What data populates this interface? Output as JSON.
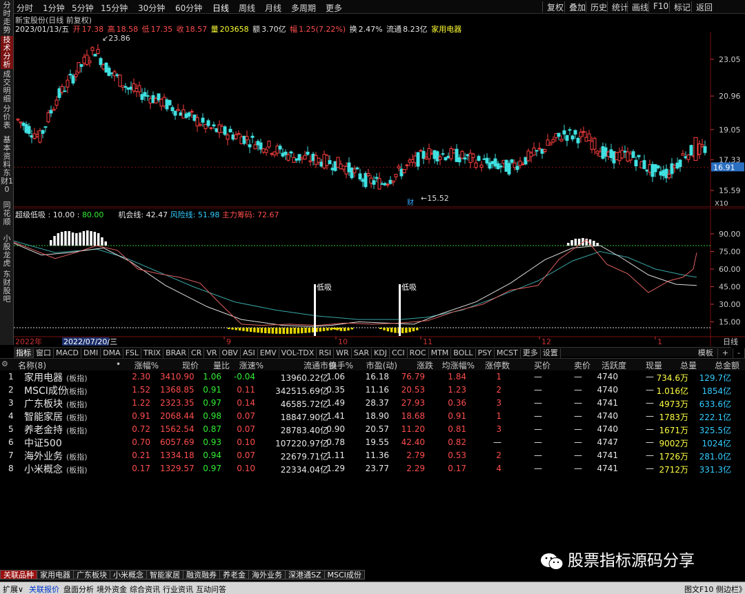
{
  "left_tabs": [
    "分时走势",
    "技术分析",
    "成交明细",
    "分价表",
    "基本资料",
    "东财10",
    "同花顺",
    "小股龙虎",
    "东财股吧"
  ],
  "left_active": 1,
  "toolbar": {
    "periods": [
      "分时",
      "1分钟",
      "5分钟",
      "15分钟",
      "30分钟",
      "60分钟",
      "日线",
      "周线",
      "月线",
      "多周期",
      "更多"
    ],
    "active_period": "日线",
    "right_buttons": [
      "复权",
      "叠加",
      "历史",
      "统计",
      "画线",
      "F10",
      "标记",
      "返回"
    ]
  },
  "stock": {
    "title": "新宝股份(日线 前复权)",
    "date": "2023/01/13/五",
    "open_label": "开",
    "open": "17.38",
    "high_label": "高",
    "high": "18.58",
    "low_label": "低",
    "low": "17.35",
    "close_label": "收",
    "close": "18.57",
    "vol_label": "量",
    "vol": "203658",
    "amt_label": "额",
    "amt": "3.70亿",
    "chg_label": "幅",
    "chg": "1.25(7.22%)",
    "turn_label": "换",
    "turn": "2.47%",
    "float_label": "流通",
    "float": "8.23亿",
    "industry": "家用电器"
  },
  "main_chart": {
    "y_ticks": [
      "23.05",
      "20.96",
      "19.05",
      "17.33",
      "15.59"
    ],
    "current_price": "16.91",
    "max_label": "23.86",
    "min_label": "15.52",
    "cai_label": "财",
    "zoom": "X10",
    "bullish_color": "#ff4040",
    "bearish_color": "#40e0e0"
  },
  "indicator": {
    "name": "超级低吸",
    "p1_label": "10.00",
    "p2_label": "80.00",
    "line1_label": "机会线",
    "line1_val": "42.47",
    "line2_label": "风险线",
    "line2_val": "51.98",
    "line3_label": "主力筹码",
    "line3_val": "72.67",
    "y_ticks": [
      "90.00",
      "75.00",
      "60.00",
      "45.00",
      "30.00",
      "15.00"
    ],
    "signal_label": "低吸"
  },
  "x_axis": {
    "year": "2022年",
    "cursor_date": "2022/07/20/三",
    "months": [
      "9",
      "10",
      "11",
      "12",
      "1"
    ],
    "right_label": "日线"
  },
  "ind_tabs": [
    "指标",
    "窗口",
    "MACD",
    "DMI",
    "DMA",
    "FSL",
    "TRIX",
    "BRAR",
    "CR",
    "VR",
    "OBV",
    "ASI",
    "EMV",
    "VOL-TDX",
    "RSI",
    "WR",
    "SAR",
    "KDJ",
    "CCI",
    "ROC",
    "MTM",
    "BOLL",
    "PSY",
    "MCST",
    "更多",
    "设置"
  ],
  "ind_tabs_right": [
    "模板",
    "+",
    "-"
  ],
  "table": {
    "headers": [
      "名称(8)",
      "•",
      "涨幅%",
      "现价",
      "量比",
      "涨速%",
      "流通市值",
      "换手%",
      "市盈(动)",
      "涨跌",
      "均涨幅%",
      "涨停数",
      "买价",
      "卖价",
      "活跃度",
      "现量",
      "总量",
      "总金额"
    ],
    "rows": [
      {
        "no": "1",
        "name": "家用电器",
        "tag": "(板指)",
        "chg": "2.30",
        "price": "3410.90",
        "vr": "1.06",
        "spd": "-0.04",
        "mcap": "13960.22亿",
        "turn": "1.06",
        "pe": "16.18",
        "diff": "76.79",
        "avg": "1.84",
        "zt": "1",
        "buy": "—",
        "sell": "—",
        "act": "4740",
        "cur": "—",
        "vol": "734.6万",
        "amt": "129.7亿"
      },
      {
        "no": "2",
        "name": "MSCI成份",
        "tag": "(板指)",
        "chg": "1.52",
        "price": "1368.85",
        "vr": "0.91",
        "spd": "0.11",
        "mcap": "342515.69亿",
        "turn": "0.35",
        "pe": "11.16",
        "diff": "20.53",
        "avg": "1.23",
        "zt": "2",
        "buy": "—",
        "sell": "—",
        "act": "4740",
        "cur": "—",
        "vol": "1.016亿",
        "amt": "1854亿"
      },
      {
        "no": "3",
        "name": "广东板块",
        "tag": "(板指)",
        "chg": "1.22",
        "price": "2323.35",
        "vr": "0.97",
        "spd": "0.14",
        "mcap": "46585.72亿",
        "turn": "1.49",
        "pe": "28.37",
        "diff": "27.93",
        "avg": "0.36",
        "zt": "3",
        "buy": "—",
        "sell": "—",
        "act": "4741",
        "cur": "—",
        "vol": "4973万",
        "amt": "633.6亿"
      },
      {
        "no": "4",
        "name": "智能家居",
        "tag": "(板指)",
        "chg": "0.91",
        "price": "2068.44",
        "vr": "0.98",
        "spd": "0.07",
        "mcap": "18847.90亿",
        "turn": "1.41",
        "pe": "18.90",
        "diff": "18.68",
        "avg": "0.91",
        "zt": "1",
        "buy": "—",
        "sell": "—",
        "act": "4740",
        "cur": "—",
        "vol": "1783万",
        "amt": "222.1亿"
      },
      {
        "no": "5",
        "name": "养老金持",
        "tag": "(板指)",
        "chg": "0.72",
        "price": "1562.54",
        "vr": "0.87",
        "spd": "0.07",
        "mcap": "28783.40亿",
        "turn": "0.90",
        "pe": "20.57",
        "diff": "11.20",
        "avg": "0.81",
        "zt": "3",
        "buy": "—",
        "sell": "—",
        "act": "4740",
        "cur": "—",
        "vol": "1671万",
        "amt": "325.5亿"
      },
      {
        "no": "6",
        "name": "中证500",
        "tag": "",
        "chg": "0.70",
        "price": "6057.69",
        "vr": "0.93",
        "spd": "0.10",
        "mcap": "107220.97亿",
        "turn": "0.78",
        "pe": "19.55",
        "diff": "42.40",
        "avg": "0.82",
        "zt": "—",
        "buy": "—",
        "sell": "—",
        "act": "4747",
        "cur": "—",
        "vol": "9002万",
        "amt": "1024亿"
      },
      {
        "no": "7",
        "name": "海外业务",
        "tag": "(板指)",
        "chg": "0.21",
        "price": "1334.18",
        "vr": "0.94",
        "spd": "0.07",
        "mcap": "22679.71亿",
        "turn": "1.11",
        "pe": "11.36",
        "diff": "2.79",
        "avg": "0.53",
        "zt": "2",
        "buy": "—",
        "sell": "—",
        "act": "4741",
        "cur": "—",
        "vol": "1726万",
        "amt": "281.0亿"
      },
      {
        "no": "8",
        "name": "小米概念",
        "tag": "(板指)",
        "chg": "0.17",
        "price": "1329.57",
        "vr": "0.97",
        "spd": "0.10",
        "mcap": "22334.04亿",
        "turn": "1.29",
        "pe": "23.77",
        "diff": "2.29",
        "avg": "0.17",
        "zt": "4",
        "buy": "—",
        "sell": "—",
        "act": "4741",
        "cur": "—",
        "vol": "2712万",
        "amt": "331.3亿"
      }
    ]
  },
  "bottom_tabs": [
    "关联品种",
    "家用电器",
    "广东板块",
    "小米概念",
    "智能家居",
    "融资融券",
    "养老金",
    "海外业务",
    "深港通SZ",
    "MSCI成份"
  ],
  "status": {
    "items": [
      "扩展∨",
      "关联报价",
      "盘面分析",
      "境外资金",
      "综合资讯",
      "行业资讯",
      "互动问答"
    ],
    "active": 1,
    "right": "图文F10 侧边栏》"
  },
  "watermark": "股票指标源码分享"
}
